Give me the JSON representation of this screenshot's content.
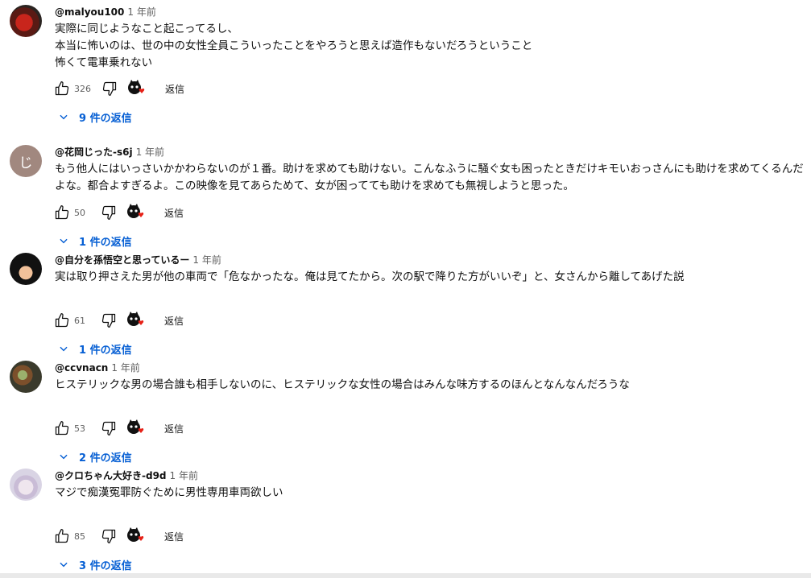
{
  "comments": [
    {
      "author": "@malyou100",
      "time": "1 年前",
      "lines": [
        "実際に同じようなこと起こってるし、",
        "本当に怖いのは、世の中の女性全員こういったことをやろうと思えば造作もないだろうということ",
        "怖くて電車乗れない"
      ],
      "likes": "326",
      "reply_label": "返信",
      "replies_label": "9 件の返信"
    },
    {
      "author": "@花岡じった-s6j",
      "avatar_letter": "じ",
      "time": "1 年前",
      "text": "もう他人にはいっさいかかわらないのが１番。助けを求めても助けない。こんなふうに騒ぐ女も困ったときだけキモいおっさんにも助けを求めてくるんだよな。都合よすぎるよ。この映像を見てあらためて、女が困ってても助けを求めても無視しようと思った。",
      "likes": "50",
      "reply_label": "返信",
      "replies_label": "1 件の返信"
    },
    {
      "author": "@自分を孫悟空と思っているー",
      "time": "1 年前",
      "text": "実は取り押さえた男が他の車両で「危なかったな。俺は見てたから。次の駅で降りた方がいいぞ」と、女さんから離してあげた説",
      "likes": "61",
      "reply_label": "返信",
      "replies_label": "1 件の返信"
    },
    {
      "author": "@ccvnacn",
      "time": "1 年前",
      "text": "ヒステリックな男の場合誰も相手しないのに、ヒステリックな女性の場合はみんな味方するのほんとなんなんだろうな",
      "likes": "53",
      "reply_label": "返信",
      "replies_label": "2 件の返信"
    },
    {
      "author": "@クロちゃん大好き-d9d",
      "time": "1 年前",
      "text": "マジで痴漢冤罪防ぐために男性専用車両欲しい",
      "likes": "85",
      "reply_label": "返信",
      "replies_label": "3 件の返信"
    }
  ],
  "colors": {
    "link_blue": "#065fd4",
    "muted": "#606060",
    "heart_red": "#e62117"
  },
  "icons": [
    "thumbs-up-icon",
    "thumbs-down-icon",
    "creator-heart-icon",
    "chevron-down-icon"
  ]
}
